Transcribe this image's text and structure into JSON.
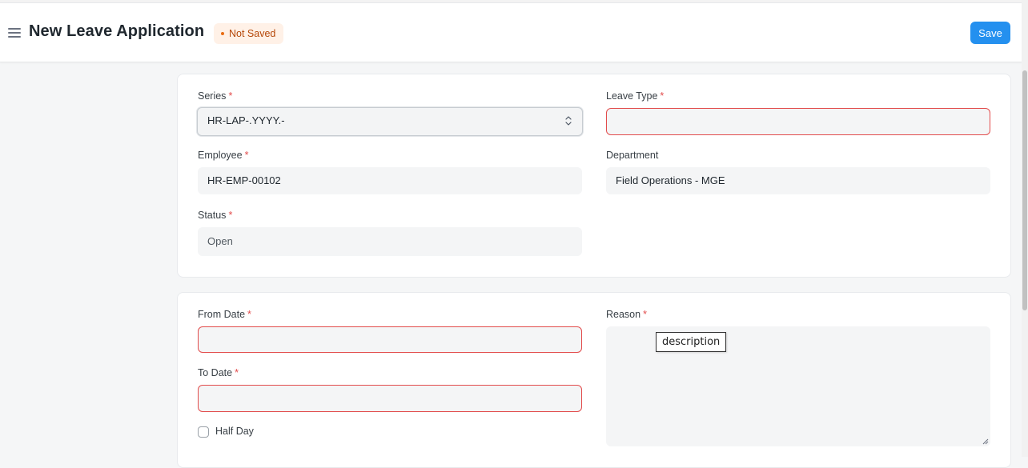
{
  "header": {
    "title": "New Leave Application",
    "status_badge": "Not Saved",
    "save_label": "Save"
  },
  "form": {
    "series": {
      "label": "Series",
      "value": "HR-LAP-.YYYY.-"
    },
    "leave_type": {
      "label": "Leave Type",
      "value": ""
    },
    "employee": {
      "label": "Employee",
      "value": "HR-EMP-00102"
    },
    "department": {
      "label": "Department",
      "value": "Field Operations - MGE"
    },
    "status": {
      "label": "Status",
      "value": "Open"
    },
    "from_date": {
      "label": "From Date",
      "value": ""
    },
    "to_date": {
      "label": "To Date",
      "value": ""
    },
    "half_day": {
      "label": "Half Day",
      "checked": false
    },
    "reason": {
      "label": "Reason",
      "value": ""
    },
    "required_marker": "*"
  },
  "tooltip": {
    "text": "description"
  },
  "icons": {
    "menu": "hamburger-icon",
    "select": "chevron-up-down-icon",
    "resize": "resize-handle-icon"
  },
  "colors": {
    "accent": "#2490ef",
    "error_border": "#e24c4c",
    "badge_bg": "#fff1e7",
    "badge_text": "#b54708"
  }
}
